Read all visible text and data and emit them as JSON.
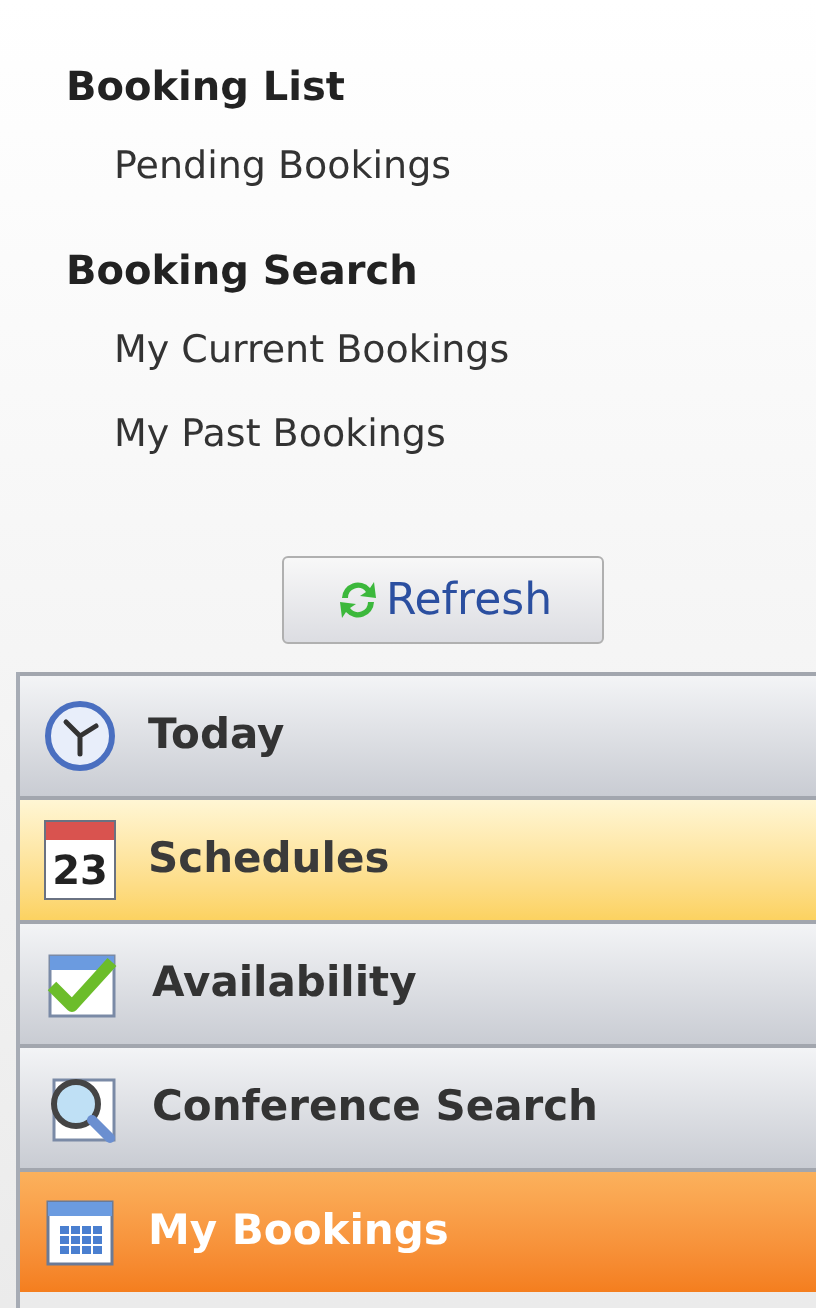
{
  "sections": [
    {
      "title": "Booking List",
      "items": [
        "Pending Bookings"
      ]
    },
    {
      "title": "Booking Search",
      "items": [
        "My Current Bookings",
        "My Past Bookings"
      ]
    }
  ],
  "refresh_button": {
    "label": "Refresh"
  },
  "nav": [
    {
      "kind": "clock",
      "label": "Today",
      "selected": false,
      "hovered": false
    },
    {
      "kind": "calendar-day",
      "label": "Schedules",
      "day": "23",
      "selected": false,
      "hovered": true
    },
    {
      "kind": "calendar-check",
      "label": "Availability",
      "selected": false,
      "hovered": false
    },
    {
      "kind": "search",
      "label": "Conference Search",
      "selected": false,
      "hovered": false
    },
    {
      "kind": "calendar-grid",
      "label": "My Bookings",
      "selected": true,
      "hovered": false
    }
  ]
}
